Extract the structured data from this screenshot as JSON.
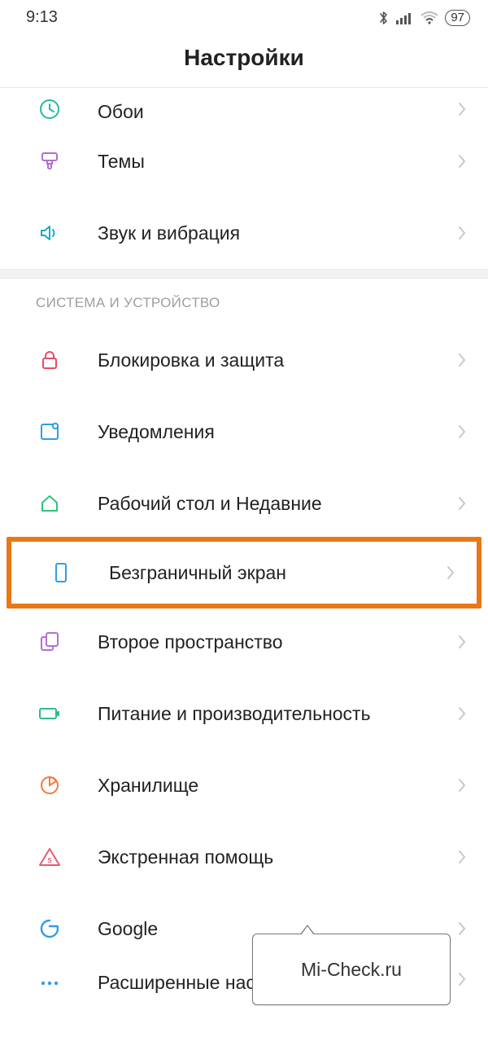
{
  "status": {
    "time": "9:13",
    "battery": "97"
  },
  "title": "Настройки",
  "sections": {
    "top": [
      {
        "label": "Обои"
      },
      {
        "label": "Темы"
      },
      {
        "label": "Звук и вибрация"
      }
    ],
    "system_header": "СИСТЕМА И УСТРОЙСТВО",
    "system": [
      {
        "label": "Блокировка и защита"
      },
      {
        "label": "Уведомления"
      },
      {
        "label": "Рабочий стол и Недавние"
      },
      {
        "label": "Безграничный экран"
      },
      {
        "label": "Второе пространство"
      },
      {
        "label": "Питание и производительность"
      },
      {
        "label": "Хранилище"
      },
      {
        "label": "Экстренная помощь"
      },
      {
        "label": "Google"
      },
      {
        "label": "Расширенные настройки"
      }
    ]
  },
  "tooltip": "Mi-Check.ru",
  "colors": {
    "highlight": "#e97817"
  }
}
